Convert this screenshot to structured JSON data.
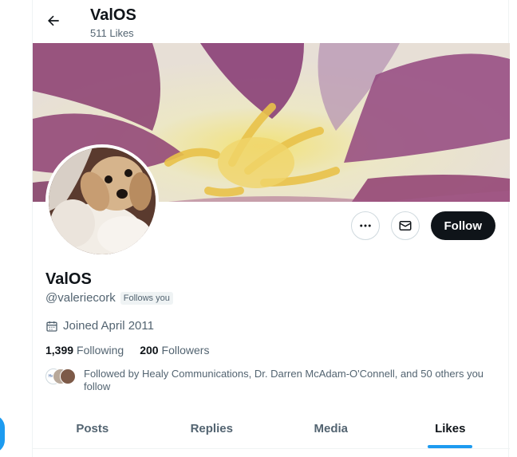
{
  "header": {
    "title": "ValOS",
    "subtitle": "511 Likes"
  },
  "profile": {
    "display_name": "ValOS",
    "handle": "@valeriecork",
    "follows_you_badge": "Follows you",
    "joined": "Joined April 2011",
    "following_count": "1,399",
    "following_label": "Following",
    "followers_count": "200",
    "followers_label": "Followers",
    "followed_by_text": "Followed by Healy Communications, Dr. Darren McAdam-O'Connell, and 50 others you follow",
    "mini_avatar_text": "Healy"
  },
  "actions": {
    "follow_label": "Follow"
  },
  "tabs": [
    {
      "label": "Posts",
      "active": false
    },
    {
      "label": "Replies",
      "active": false
    },
    {
      "label": "Media",
      "active": false
    },
    {
      "label": "Likes",
      "active": true
    }
  ],
  "colors": {
    "accent": "#1d9bf0",
    "text": "#0f1419",
    "muted": "#536471",
    "follow_bg": "#0f1419"
  },
  "icons": [
    "back-arrow-icon",
    "more-icon",
    "mail-icon",
    "calendar-icon"
  ]
}
